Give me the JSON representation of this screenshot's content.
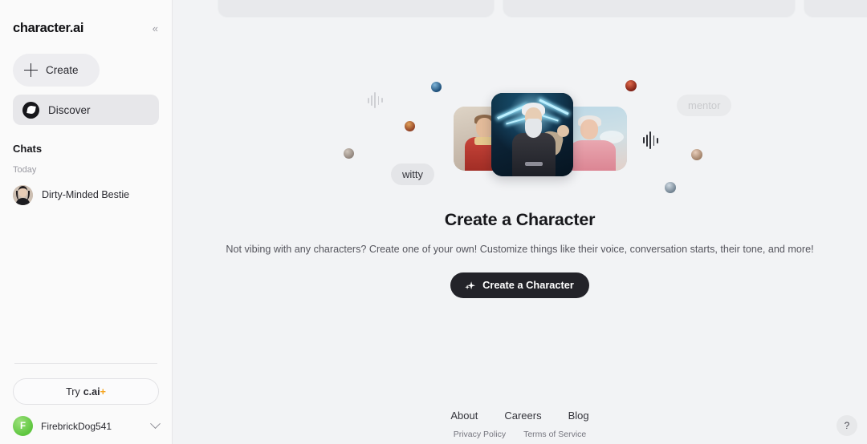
{
  "sidebar": {
    "brand": "character.ai",
    "collapse_icon": "«",
    "create_label": "Create",
    "nav": [
      {
        "label": "Discover",
        "icon": "compass-icon",
        "active": true
      }
    ],
    "chats_section_title": "Chats",
    "chats_group_label": "Today",
    "chats": [
      {
        "label": "Dirty-Minded Bestie"
      }
    ],
    "try_plus": {
      "prefix": "Try",
      "brand": "c.ai",
      "plus": "+"
    },
    "user": {
      "initial": "F",
      "name": "FirebrickDog541"
    }
  },
  "hero": {
    "pills": [
      {
        "label": "witty"
      },
      {
        "label": "mentor"
      }
    ],
    "cards": [
      {
        "name": "roman-character-card"
      },
      {
        "name": "zeus-character-card"
      },
      {
        "name": "elderly-lady-character-card"
      }
    ]
  },
  "main": {
    "title": "Create a Character",
    "subtitle": "Not vibing with any characters? Create one of your own! Customize things like their voice, conversation starts, their tone, and more!",
    "cta_label": "Create a Character"
  },
  "footer": {
    "primary": [
      "About",
      "Careers",
      "Blog"
    ],
    "secondary": [
      "Privacy Policy",
      "Terms of Service"
    ]
  },
  "help": {
    "label": "?"
  },
  "colors": {
    "sidebar_bg": "#fafafa",
    "main_bg": "#f2f3f5",
    "cta_bg": "#232329",
    "accent_plus": "#f5a623",
    "avatar_green": "#5ec63f"
  }
}
